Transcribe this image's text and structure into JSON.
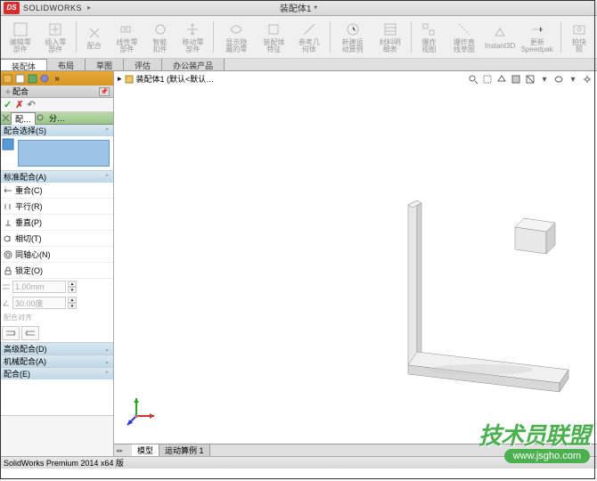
{
  "app": {
    "name": "SOLIDWORKS",
    "doc": "装配体1 *"
  },
  "ribbon": [
    {
      "label": "编辑零部件"
    },
    {
      "label": "插入零部件"
    },
    {
      "label": "配合"
    },
    {
      "label": "线性零部件"
    },
    {
      "label": "智能扣件"
    },
    {
      "label": "移动零部件"
    },
    {
      "label": "显示隐藏的零"
    },
    {
      "label": "装配体特征"
    },
    {
      "label": "参考几何体"
    },
    {
      "label": "新建运动算例"
    },
    {
      "label": "材料明细表"
    },
    {
      "label": "爆炸视图"
    },
    {
      "label": "爆炸直线草图"
    },
    {
      "label": "Instant3D"
    },
    {
      "label": "更新Speedpak"
    },
    {
      "label": "拍快照"
    }
  ],
  "tabs": [
    "装配体",
    "布局",
    "草图",
    "评估",
    "办公装产品"
  ],
  "sidebar": {
    "header": "配合",
    "tabs": [
      "配…",
      "分…"
    ],
    "sections": {
      "selection": "配合选择(S)",
      "standard": "标准配合(A)",
      "advanced": "高级配合(D)",
      "mechanical": "机械配合(A)",
      "mates": "配合(E)"
    },
    "mates": [
      {
        "label": "重合(C)"
      },
      {
        "label": "平行(R)"
      },
      {
        "label": "垂直(P)"
      },
      {
        "label": "相切(T)"
      },
      {
        "label": "同轴心(N)"
      },
      {
        "label": "锁定(O)"
      }
    ],
    "inputs": {
      "dist": "1.00mm",
      "angle": "30.00度",
      "align": "配合对齐"
    }
  },
  "breadcrumb": {
    "text": "装配体1  (默认<默认…"
  },
  "bottom_tabs": [
    "模型",
    "运动算例 1"
  ],
  "statusbar": "SolidWorks Premium 2014 x64 版",
  "watermark": {
    "text": "技术员联盟",
    "url": "www.jsgho.com"
  }
}
